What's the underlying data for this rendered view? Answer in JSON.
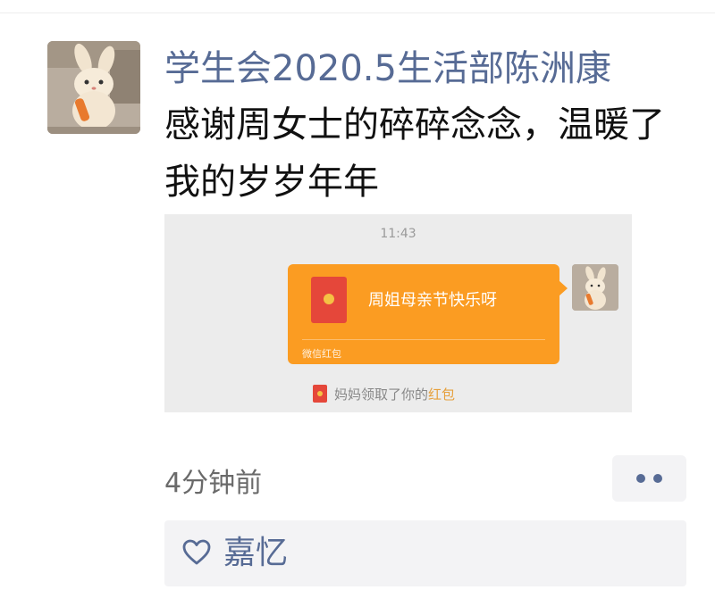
{
  "post": {
    "author": "学生会2020.5生活部陈洲康",
    "text": "感谢周女士的碎碎念念，温暖了我的岁岁年年",
    "time_ago": "4分钟前"
  },
  "screenshot": {
    "time": "11:43",
    "red_packet": {
      "message": "周姐母亲节快乐呀",
      "label": "微信红包"
    },
    "notice": {
      "prefix": "妈妈领取了你的",
      "highlight": "红包"
    }
  },
  "likes": {
    "icon": "heart-outline-icon",
    "names": "嘉忆"
  },
  "colors": {
    "link_blue": "#576b95",
    "red_packet_orange": "#fb9c22",
    "envelope_red": "#e5473a",
    "panel_gray": "#f3f3f5"
  }
}
